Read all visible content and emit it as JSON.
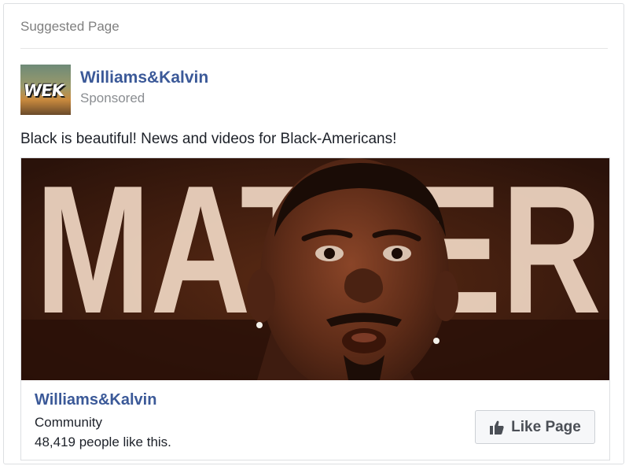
{
  "card": {
    "header": "Suggested Page"
  },
  "post": {
    "page_name": "Williams&Kalvin",
    "sponsored_label": "Sponsored",
    "avatar_text": "WEK",
    "text": "Black is beautiful! News and videos for Black-Americans!"
  },
  "media": {
    "background_word": "MATTER",
    "page_name": "Williams&Kalvin",
    "category": "Community",
    "likes_text": "48,419 people like this.",
    "like_button_label": "Like Page"
  },
  "colors": {
    "link_blue": "#3b5998",
    "muted_text": "#8a8d91",
    "button_bg": "#f6f7f9"
  },
  "icons": {
    "like_button": "thumbs-up-icon"
  }
}
